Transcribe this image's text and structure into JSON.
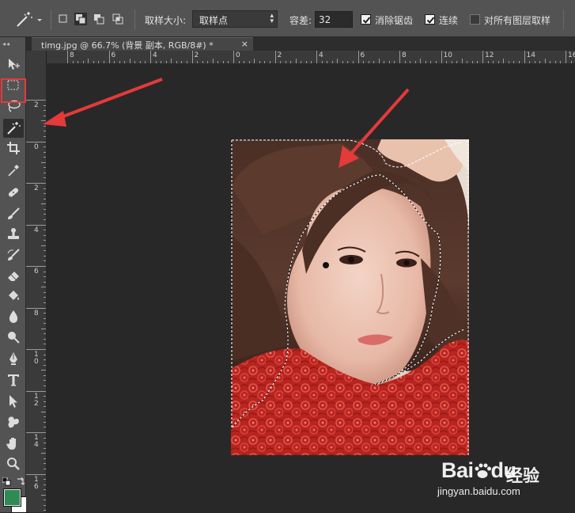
{
  "options_bar": {
    "tool_icon": "magic-wand-icon",
    "selection_modes": [
      "new-selection-icon",
      "add-to-selection-icon",
      "subtract-from-selection-icon",
      "intersect-selection-icon"
    ],
    "sample_size_label": "取样大小:",
    "sample_size_value": "取样点",
    "tolerance_label": "容差:",
    "tolerance_value": "32",
    "anti_alias_label": "消除锯齿",
    "anti_alias_checked": true,
    "contiguous_label": "连续",
    "contiguous_checked": true,
    "sample_all_layers_label": "对所有图层取样",
    "sample_all_layers_checked": false
  },
  "document_tab": {
    "title": "timg.jpg @ 66.7% (背景 副本, RGB/8#) *",
    "close_glyph": "×"
  },
  "rulers": {
    "horizontal_labels": [
      "8",
      "6",
      "4",
      "2",
      "0",
      "2",
      "4",
      "6",
      "8",
      "10",
      "12",
      "14",
      "16",
      "18",
      "20"
    ],
    "vertical_labels": [
      "2",
      "0",
      "2",
      "4",
      "6",
      "8",
      "1 0",
      "1 2",
      "1 4",
      "1 6"
    ]
  },
  "tools": [
    "move-icon",
    "marquee-icon",
    "lasso-icon",
    "magic-wand-icon",
    "crop-icon",
    "eyedropper-icon",
    "healing-brush-icon",
    "brush-icon",
    "clone-stamp-icon",
    "history-brush-icon",
    "eraser-icon",
    "paint-bucket-icon",
    "blur-icon",
    "dodge-icon",
    "pen-icon",
    "type-icon",
    "path-selection-icon",
    "custom-shape-icon",
    "hand-icon",
    "zoom-icon"
  ],
  "active_tool": "magic-wand-icon",
  "colors": {
    "foreground": "#2f8a56",
    "background": "#ffffff",
    "annotation_red": "#e43a3a"
  },
  "watermark": {
    "brand": "Bai",
    "brand_suffix": "du",
    "chinese": "经验",
    "url": "jingyan.baidu.com"
  }
}
